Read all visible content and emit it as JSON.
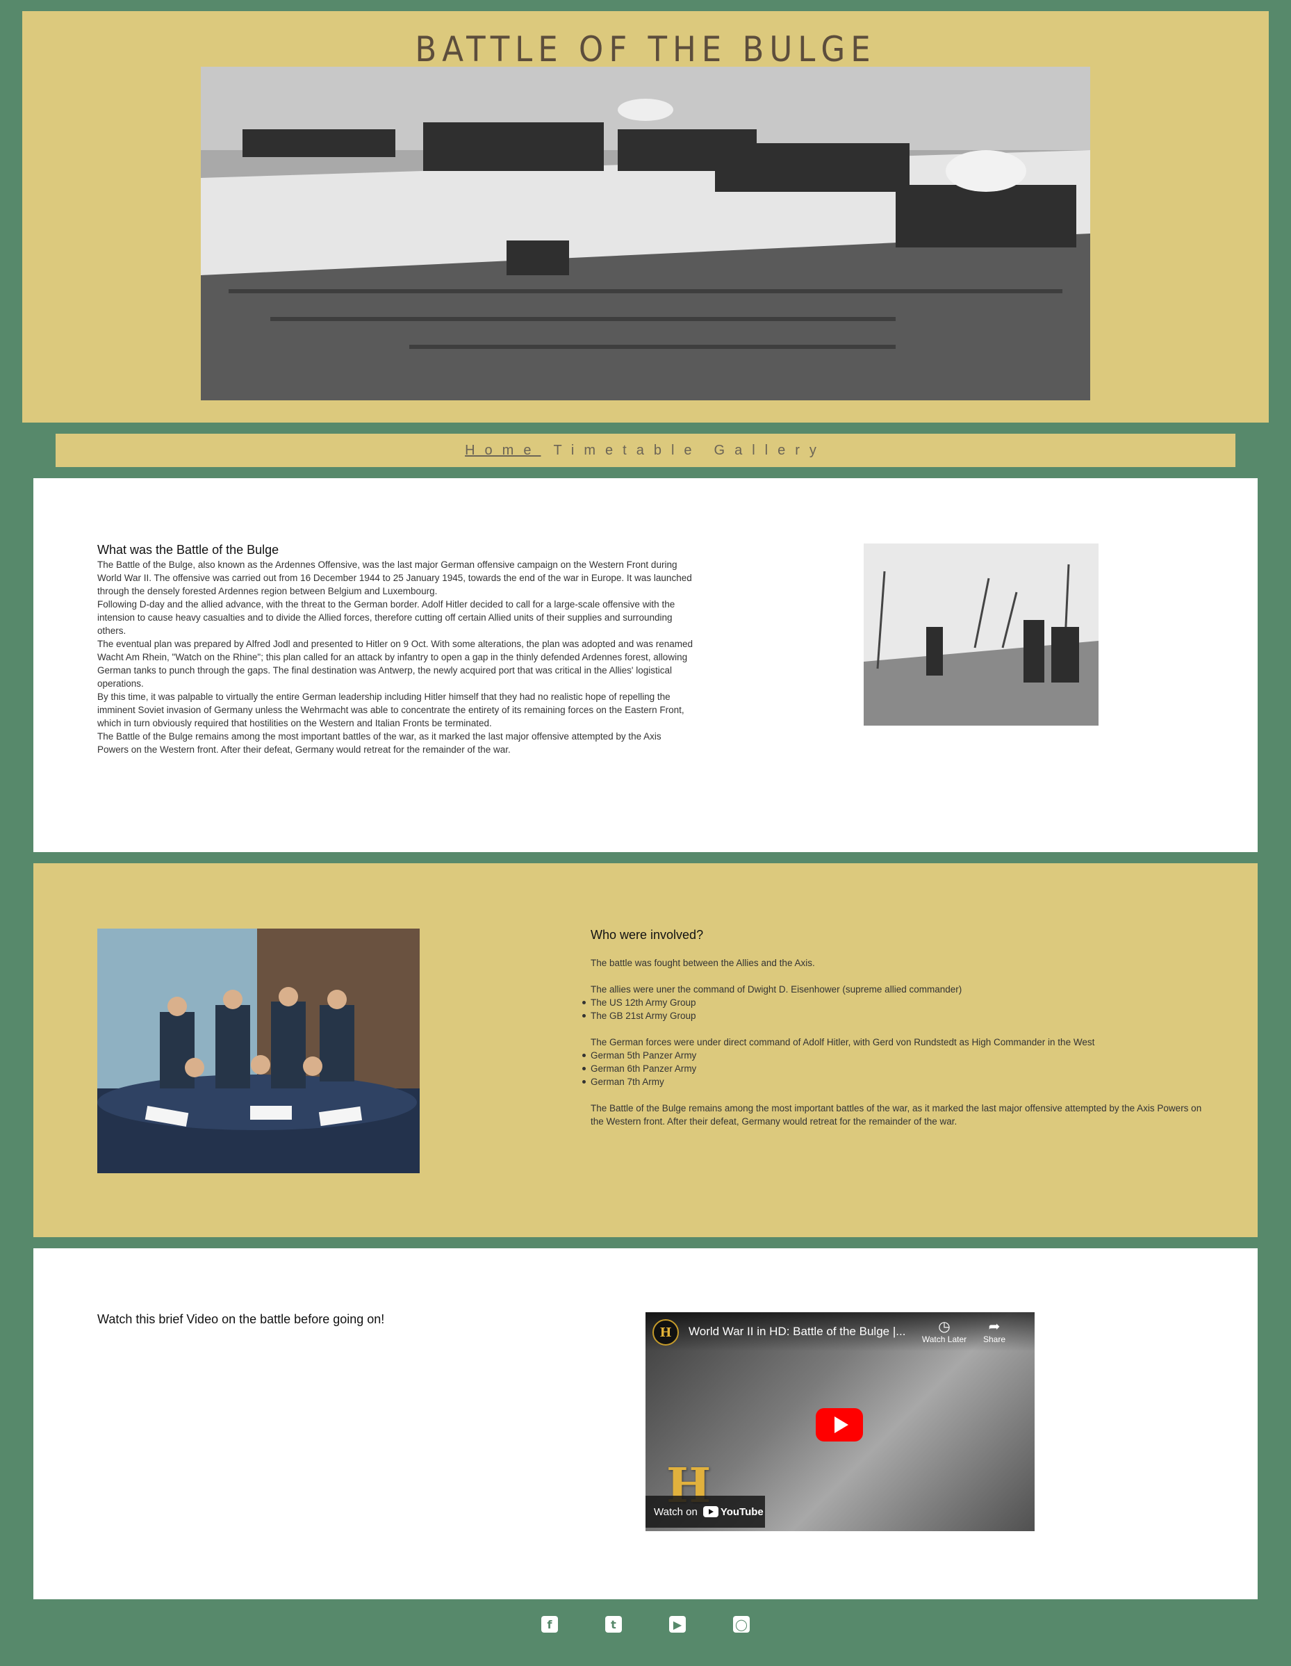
{
  "header": {
    "title": "BATTLE OF THE BULGE"
  },
  "nav": {
    "items": [
      {
        "label": "Home",
        "active": true
      },
      {
        "label": "Timetable",
        "active": false
      },
      {
        "label": "Gallery",
        "active": false
      }
    ]
  },
  "section_what": {
    "heading": "What was the Battle of the Bulge",
    "paragraphs": [
      "The Battle of the Bulge, also known as the Ardennes Offensive, was the last major German offensive campaign on the Western Front during World War II. The offensive was carried out from 16 December 1944 to 25 January 1945, towards the end of the war in Europe. It was launched through the densely forested Ardennes region between Belgium and Luxembourg.",
      "Following D-day and the allied advance, with the threat to the German border. Adolf Hitler decided to call for a large-scale offensive with the intension to cause heavy casualties and to divide the Allied forces, therefore cutting off certain Allied units of their supplies and surrounding others.",
      "The eventual plan was prepared by Alfred Jodl and presented to Hitler on 9 Oct. With some alterations, the plan was adopted and was renamed Wacht Am Rhein, \"Watch on the Rhine\"; this plan called for an attack by infantry to open a gap in the thinly defended Ardennes forest, allowing German tanks to punch through the gaps. The final destination was Antwerp, the newly acquired port that was critical in the Allies' logistical operations.",
      "By this time, it was palpable to virtually the entire German leadership including Hitler himself that they had no realistic hope of repelling the imminent Soviet invasion of Germany unless the Wehrmacht was able to concentrate the entirety of its remaining forces on the Eastern Front, which in turn obviously required that hostilities on the Western and Italian Fronts be terminated.",
      "The Battle of the Bulge remains among the most important battles of the war, as it marked the last major offensive attempted by the Axis Powers on the Western front. After their defeat, Germany would retreat for the remainder of the war."
    ]
  },
  "section_who": {
    "heading": "Who were involved?",
    "intro": "The battle was fought between the Allies and the Axis.",
    "allies_text": "The allies were uner the command of Dwight D. Eisenhower (supreme allied commander)",
    "allies": [
      "The US 12th Army Group",
      "The GB 21st Army Group"
    ],
    "axis_text": "The German forces were under direct command of Adolf Hitler, with Gerd von Rundstedt as High Commander in the West",
    "axis": [
      "German 5th Panzer Army",
      "German 6th Panzer Army",
      "German 7th Army"
    ],
    "closing": "The Battle of the Bulge remains among the most important battles of the war, as it marked the last major offensive attempted by the Axis Powers on the Western front. After their defeat, Germany would retreat for the remainder of the war."
  },
  "section_video": {
    "heading": "Watch this brief Video on the battle before going on!",
    "video_title": "World War II in HD: Battle of the Bulge |...",
    "channel_letter": "H",
    "watch_later": "Watch Later",
    "share": "Share",
    "watch_on": "Watch on",
    "youtube": "YouTube",
    "logo_letter": "H"
  },
  "footer": {
    "icons": [
      "facebook-icon",
      "twitter-icon",
      "youtube-icon",
      "instagram-icon"
    ]
  },
  "colors": {
    "background": "#57896b",
    "accent": "#dcc97d",
    "panel": "#ffffff"
  }
}
